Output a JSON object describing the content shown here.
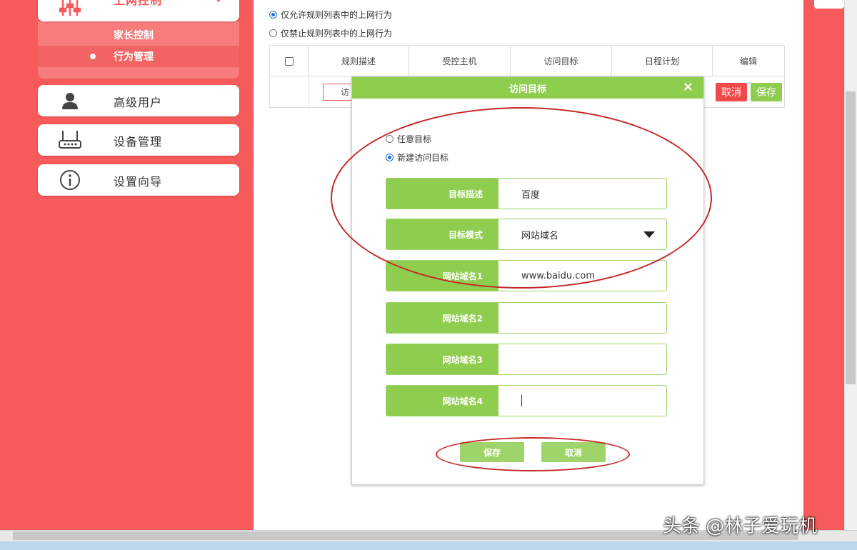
{
  "sidebar": {
    "top_item": {
      "label": "上网控制",
      "icon": "sliders-icon"
    },
    "sub_items": [
      {
        "label": "家长控制"
      },
      {
        "label": "行为管理"
      }
    ],
    "items": [
      {
        "label": "高级用户",
        "icon": "user-icon"
      },
      {
        "label": "设备管理",
        "icon": "router-icon"
      },
      {
        "label": "设置向导",
        "icon": "info-icon"
      }
    ]
  },
  "main": {
    "mode_options": [
      {
        "label": "仅允许规则列表中的上网行为",
        "selected": true
      },
      {
        "label": "仅禁止规则列表中的上网行为",
        "selected": false
      }
    ],
    "table": {
      "columns": [
        "规则描述",
        "受控主机",
        "访问目标",
        "日程计划",
        "编辑"
      ],
      "row_input_value": "访",
      "cancel_label": "取消",
      "save_label": "保存"
    }
  },
  "dialog": {
    "title": "访问目标",
    "close_label": "×",
    "options": [
      {
        "label": "任意目标",
        "selected": false
      },
      {
        "label": "新建访问目标",
        "selected": true
      }
    ],
    "fields": [
      {
        "label": "目标描述",
        "value": "百度"
      },
      {
        "label": "目标模式",
        "value": "网站域名"
      },
      {
        "label": "网站域名1",
        "value": "www.baidu.com"
      },
      {
        "label": "网站域名2",
        "value": ""
      },
      {
        "label": "网站域名3",
        "value": ""
      },
      {
        "label": "网站域名4",
        "value": ""
      }
    ],
    "save_label": "保存",
    "cancel_label": "取消"
  },
  "watermark": "头条 @林子爱玩机",
  "colors": {
    "sidebar": "#f65a5a",
    "accent_green": "#8fcd4f",
    "annotation_red": "#c62828"
  }
}
